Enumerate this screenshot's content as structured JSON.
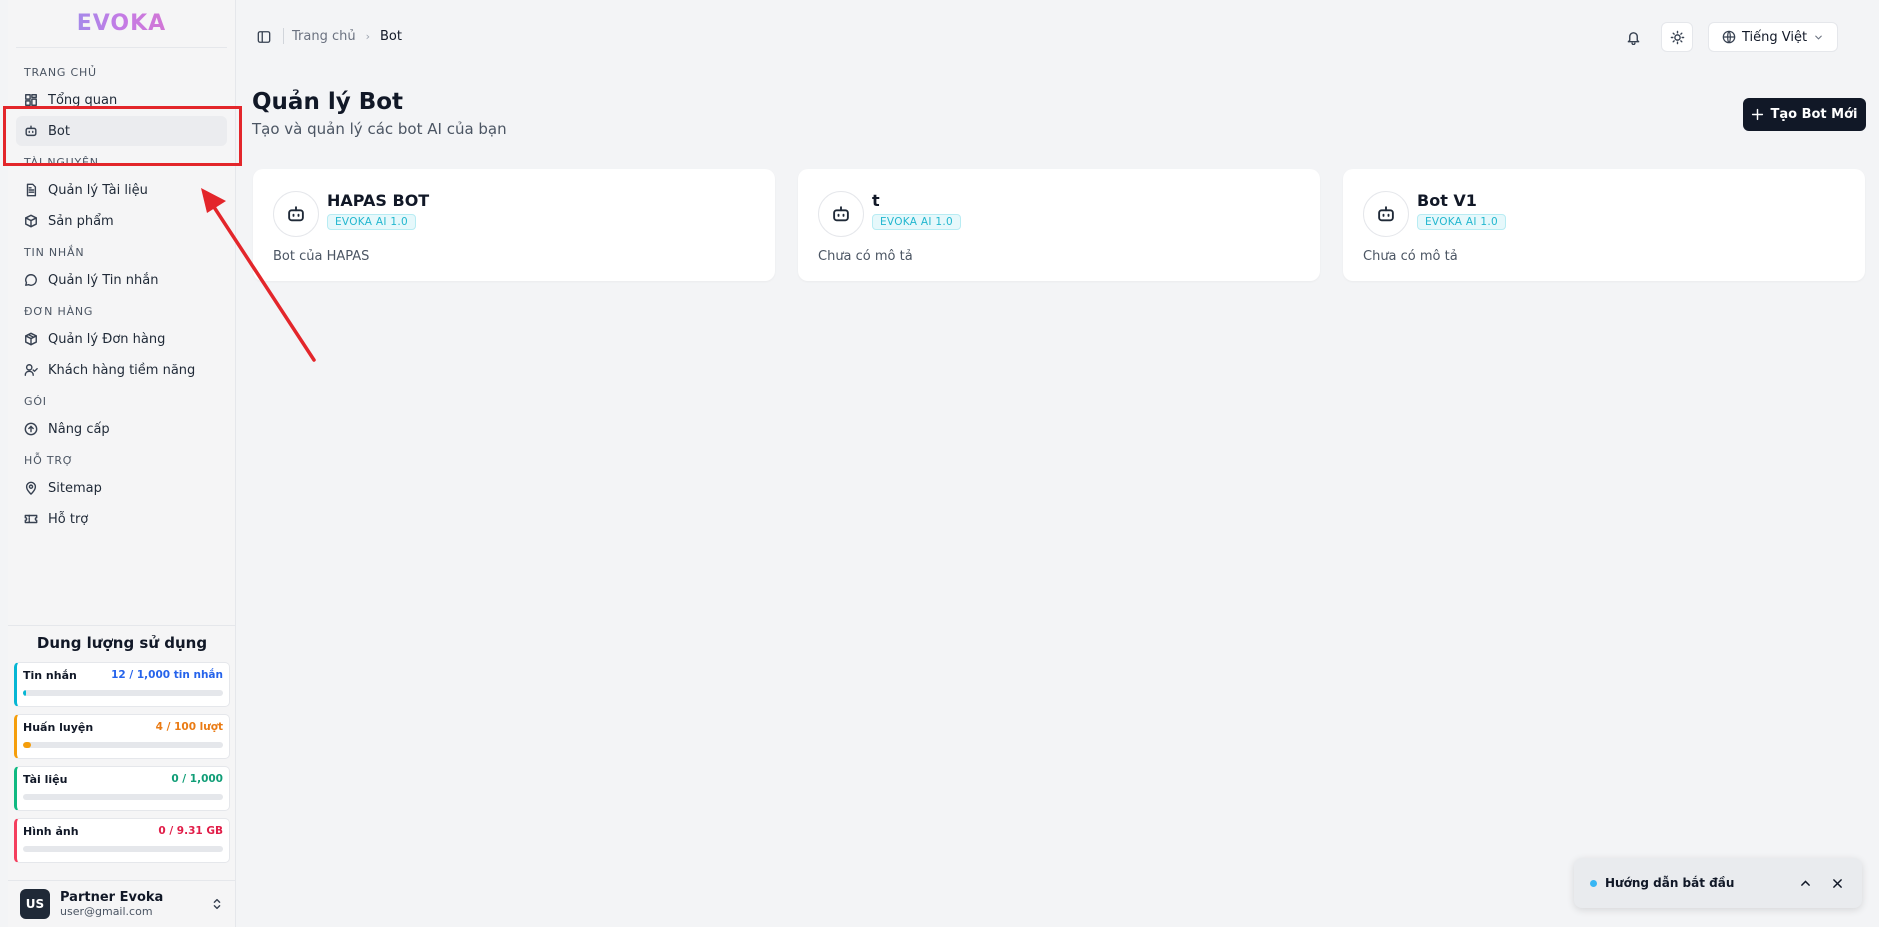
{
  "app": {
    "logo": "EVOKA"
  },
  "sidebar": {
    "sections": [
      {
        "title": "TRANG CHỦ",
        "items": [
          {
            "label": "Tổng quan",
            "icon": "dashboard-icon"
          },
          {
            "label": "Bot",
            "icon": "bot-icon",
            "active": true
          }
        ]
      },
      {
        "title": "TÀI NGUYÊN",
        "items": [
          {
            "label": "Quản lý Tài liệu",
            "icon": "file-icon"
          },
          {
            "label": "Sản phẩm",
            "icon": "box-icon"
          }
        ]
      },
      {
        "title": "TIN NHẮN",
        "items": [
          {
            "label": "Quản lý Tin nhắn",
            "icon": "chat-icon"
          }
        ]
      },
      {
        "title": "ĐƠN HÀNG",
        "items": [
          {
            "label": "Quản lý Đơn hàng",
            "icon": "package-icon"
          },
          {
            "label": "Khách hàng tiềm năng",
            "icon": "user-check-icon"
          }
        ]
      },
      {
        "title": "GÓI",
        "items": [
          {
            "label": "Nâng cấp",
            "icon": "upgrade-icon"
          }
        ]
      },
      {
        "title": "HỖ TRỢ",
        "items": [
          {
            "label": "Sitemap",
            "icon": "map-pin-icon"
          },
          {
            "label": "Hỗ trợ",
            "icon": "ticket-icon"
          }
        ]
      }
    ]
  },
  "usage": {
    "title": "Dung lượng sử dụng",
    "items": [
      {
        "label": "Tin nhắn",
        "value": "12 / 1,000 tin nhắn",
        "color": "#2563eb",
        "border": "#06b6d4",
        "bar": "#06b6d4",
        "fraction": 0.012
      },
      {
        "label": "Huấn luyện",
        "value": "4 / 100 lượt",
        "color": "#ea7b14",
        "border": "#f59e0b",
        "bar": "#f59e0b",
        "fraction": 0.04
      },
      {
        "label": "Tài liệu",
        "value": "0 / 1,000",
        "color": "#0f9d76",
        "border": "#10b981",
        "bar": "#10b981",
        "fraction": 0
      },
      {
        "label": "Hình ảnh",
        "value": "0 / 9.31 GB",
        "color": "#e11d48",
        "border": "#f43f5e",
        "bar": "#f43f5e",
        "fraction": 0
      }
    ]
  },
  "user": {
    "initials": "US",
    "name": "Partner Evoka",
    "email": "user@gmail.com"
  },
  "header": {
    "breadcrumb": {
      "home": "Trang chủ",
      "current": "Bot"
    },
    "language": "Tiếng Việt"
  },
  "main": {
    "title": "Quản lý Bot",
    "subtitle": "Tạo và quản lý các bot AI của bạn",
    "create_button": "Tạo Bot Mới",
    "bots": [
      {
        "name": "HAPAS BOT",
        "badge": "EVOKA AI 1.0",
        "description": "Bot của HAPAS"
      },
      {
        "name": "t",
        "badge": "EVOKA AI 1.0",
        "description": "Chưa có mô tả"
      },
      {
        "name": "Bot V1",
        "badge": "EVOKA AI 1.0",
        "description": "Chưa có mô tả"
      }
    ]
  },
  "guide": {
    "label": "Hướng dẫn bắt đầu"
  },
  "colors": {
    "accent": "#111827",
    "annotation": "#e3262b"
  }
}
